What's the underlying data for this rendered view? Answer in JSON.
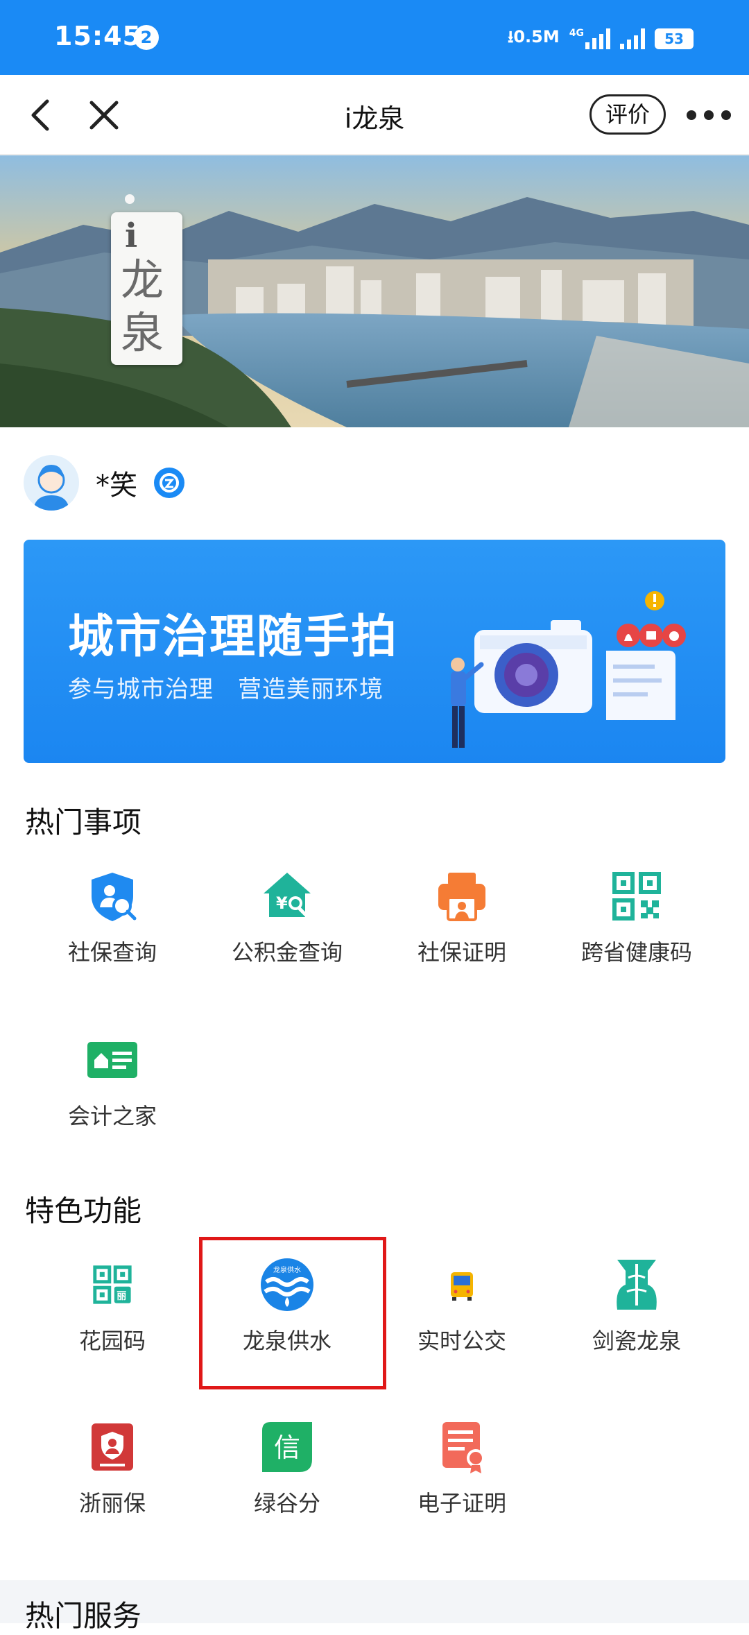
{
  "status_bar": {
    "time": "15:45",
    "notification_count": "2",
    "net_speed": "0.5M",
    "network": "4G",
    "battery": "53"
  },
  "nav": {
    "title": "i龙泉",
    "rate_label": "评价"
  },
  "hero": {
    "logo_i": "i",
    "logo_text": "龙泉"
  },
  "user": {
    "name": "*笑"
  },
  "promo": {
    "title": "城市治理随手拍",
    "subtitle": "参与城市治理　营造美丽环境"
  },
  "hot_items": {
    "title": "热门事项",
    "items": [
      {
        "label": "社保查询",
        "icon": "social-security-search-icon"
      },
      {
        "label": "公积金查询",
        "icon": "housing-fund-search-icon"
      },
      {
        "label": "社保证明",
        "icon": "printer-icon"
      },
      {
        "label": "跨省健康码",
        "icon": "qr-code-icon"
      },
      {
        "label": "会计之家",
        "icon": "accountant-card-icon"
      }
    ]
  },
  "features": {
    "title": "特色功能",
    "items": [
      {
        "label": "花园码",
        "icon": "garden-code-icon"
      },
      {
        "label": "龙泉供水",
        "icon": "water-supply-icon",
        "badge_text": "龙泉供水"
      },
      {
        "label": "实时公交",
        "icon": "bus-icon"
      },
      {
        "label": "剑瓷龙泉",
        "icon": "sword-porcelain-icon"
      },
      {
        "label": "浙丽保",
        "icon": "insurance-shield-icon"
      },
      {
        "label": "绿谷分",
        "icon": "credit-score-icon",
        "badge_text": "信"
      },
      {
        "label": "电子证明",
        "icon": "e-certificate-icon"
      }
    ]
  },
  "hot_services": {
    "title": "热门服务"
  },
  "colors": {
    "brand_blue": "#1a8af5",
    "highlight_red": "#e01818"
  }
}
